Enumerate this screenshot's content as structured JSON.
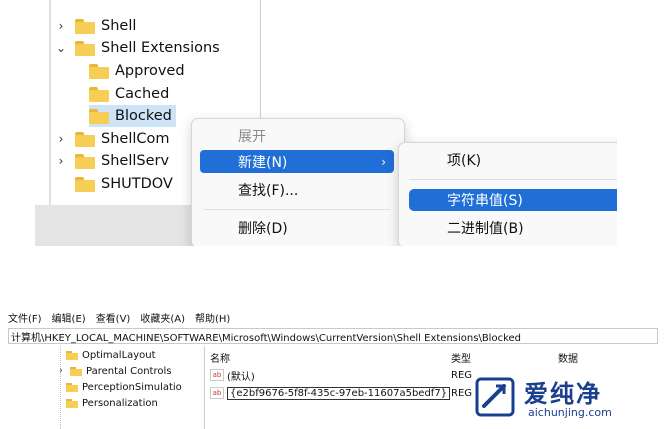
{
  "top_tree": {
    "items": [
      {
        "label": "Shell",
        "chevron": "›"
      },
      {
        "label": "Shell Extensions",
        "chevron": "⌄"
      },
      {
        "label": "Approved"
      },
      {
        "label": "Cached"
      },
      {
        "label": "Blocked"
      },
      {
        "label": "ShellCom",
        "chevron": "›"
      },
      {
        "label": "ShellServ",
        "chevron": "›"
      },
      {
        "label": "SHUTDOV"
      }
    ]
  },
  "context_menu": {
    "items": [
      {
        "label": "展开"
      },
      {
        "label": "新建(N)",
        "arrow": "›"
      },
      {
        "label": "查找(F)..."
      },
      {
        "label": "删除(D)"
      }
    ]
  },
  "submenu": {
    "items": [
      {
        "label": "项(K)"
      },
      {
        "label": "字符串值(S)"
      },
      {
        "label": "二进制值(B)"
      }
    ]
  },
  "regedit": {
    "menu": [
      "文件(F)",
      "编辑(E)",
      "查看(V)",
      "收藏夹(A)",
      "帮助(H)"
    ],
    "address": "计算机\\HKEY_LOCAL_MACHINE\\SOFTWARE\\Microsoft\\Windows\\CurrentVersion\\Shell Extensions\\Blocked",
    "tree": [
      {
        "label": "OptimalLayout"
      },
      {
        "label": "Parental Controls",
        "chevron": "›"
      },
      {
        "label": "PerceptionSimulatio"
      },
      {
        "label": "Personalization"
      }
    ],
    "columns": {
      "name": "名称",
      "type": "类型",
      "data": "数据"
    },
    "rows": [
      {
        "icon": "ab",
        "name": "(默认)",
        "type": "REG"
      },
      {
        "icon": "ab",
        "name": "{e2bf9676-5f8f-435c-97eb-11607a5bedf7}",
        "type": "REG"
      }
    ]
  },
  "watermark": {
    "title": "爱纯净",
    "url": "aichunjing.com",
    "color": "#1a3f8f"
  }
}
